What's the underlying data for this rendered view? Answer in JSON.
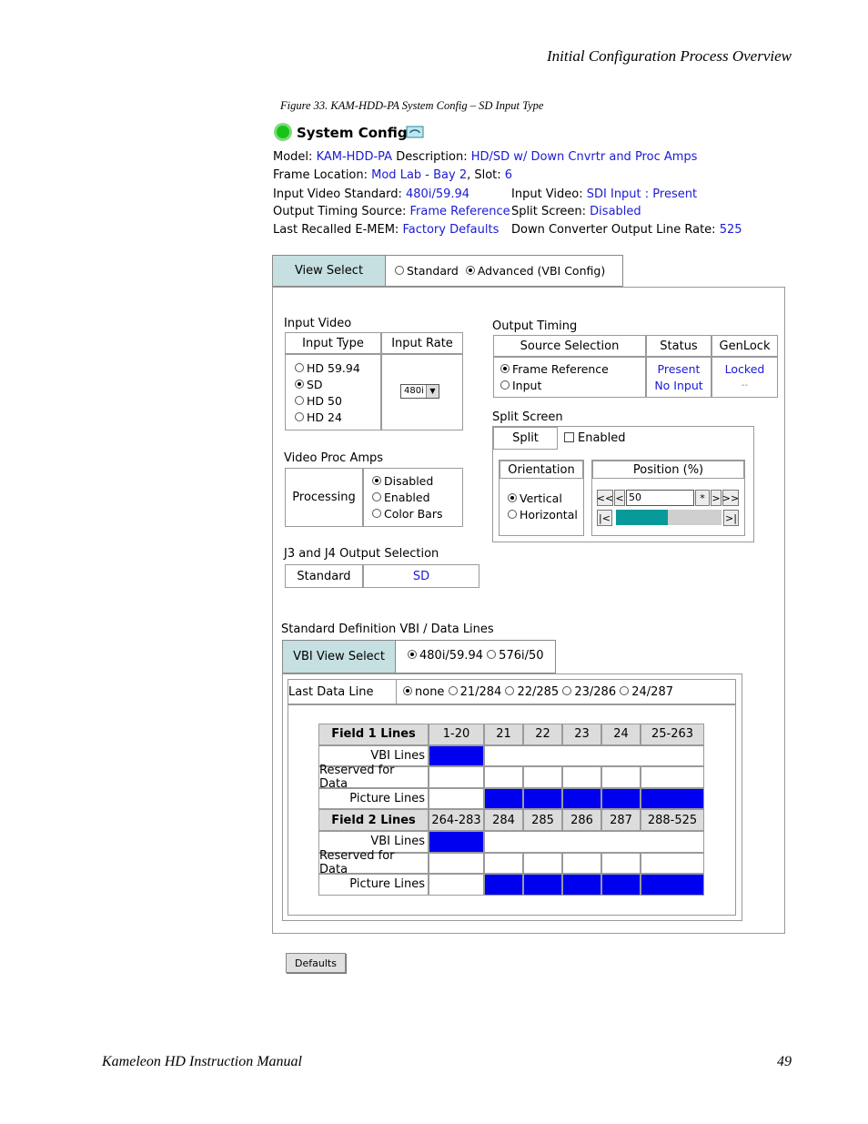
{
  "page": {
    "header": "Initial Configuration Process Overview",
    "caption": "Figure 33.  KAM-HDD-PA System Config – SD Input Type",
    "footer_left": "Kameleon HD Instruction Manual",
    "page_number": "49"
  },
  "sysconfig": {
    "title": "System Config",
    "model_label": "Model:",
    "model_value": "KAM-HDD-PA",
    "description_label": "Description:",
    "description_value": "HD/SD w/ Down Cnvrtr and Proc Amps",
    "frame_location_label": "Frame Location:",
    "frame_location_value": "Mod Lab - Bay 2",
    "slot_label": ", Slot:",
    "slot_value": "6",
    "input_standard_label": "Input Video Standard:",
    "input_standard_value": "480i/59.94",
    "input_video_label": "Input Video:",
    "input_video_value": "SDI Input : Present",
    "output_timing_label": "Output Timing Source:",
    "output_timing_value": "Frame Reference",
    "split_screen_label": "Split Screen:",
    "split_screen_value": "Disabled",
    "last_recalled_label": "Last Recalled E-MEM:",
    "last_recalled_value": "Factory Defaults",
    "down_conv_label": "Down Converter Output Line Rate:",
    "down_conv_value": "525"
  },
  "view_select": {
    "label": "View Select",
    "options": [
      "Standard",
      "Advanced (VBI Config)"
    ],
    "selected": "Advanced (VBI Config)"
  },
  "input_video": {
    "title": "Input Video",
    "col_type": "Input Type",
    "col_rate": "Input Rate",
    "types": [
      "HD 59.94",
      "SD",
      "HD 50",
      "HD 24"
    ],
    "selected_type": "SD",
    "rate_value": "480i"
  },
  "output_timing": {
    "title": "Output Timing",
    "col_source": "Source Selection",
    "col_status": "Status",
    "col_genlock": "GenLock",
    "sources": [
      "Frame Reference",
      "Input"
    ],
    "selected_source": "Frame Reference",
    "status": [
      "Present",
      "No Input"
    ],
    "genlock": [
      "Locked",
      "--"
    ]
  },
  "split_screen": {
    "title": "Split Screen",
    "split_label": "Split",
    "enabled_label": "Enabled",
    "orientation_label": "Orientation",
    "orientations": [
      "Vertical",
      "Horizontal"
    ],
    "selected_orientation": "Vertical",
    "position_label": "Position (%)",
    "position_value": "50",
    "btn_first": "<<",
    "btn_prev": "<",
    "btn_star": "*",
    "btn_next": ">",
    "btn_last": ">>",
    "btn_min": "|<",
    "btn_max": ">|",
    "slider_fraction": 0.5
  },
  "proc_amps": {
    "title": "Video Proc Amps",
    "label": "Processing",
    "options": [
      "Disabled",
      "Enabled",
      "Color Bars"
    ],
    "selected": "Disabled"
  },
  "j3j4": {
    "title": "J3 and J4 Output Selection",
    "label": "Standard",
    "value": "SD"
  },
  "vbi": {
    "title": "Standard Definition VBI / Data Lines",
    "view_select_label": "VBI View Select",
    "view_options": [
      "480i/59.94",
      "576i/50"
    ],
    "view_selected": "480i/59.94",
    "last_line_label": "Last Data Line",
    "last_line_options": [
      "none",
      "21/284",
      "22/285",
      "23/286",
      "24/287"
    ],
    "last_line_selected": "none",
    "field1_label": "Field 1 Lines",
    "field1_cols": [
      "1-20",
      "21",
      "22",
      "23",
      "24",
      "25-263"
    ],
    "field2_label": "Field 2 Lines",
    "field2_cols": [
      "264-283",
      "284",
      "285",
      "286",
      "287",
      "288-525"
    ],
    "row_vbi": "VBI Lines",
    "row_reserved": "Reserved for Data",
    "row_picture": "Picture Lines"
  },
  "defaults_button": "Defaults",
  "colors": {
    "link": "#1a1ad6",
    "blue_fill": "#0000f0",
    "teal": "#089a9a",
    "tab": "#c6dfe0"
  }
}
